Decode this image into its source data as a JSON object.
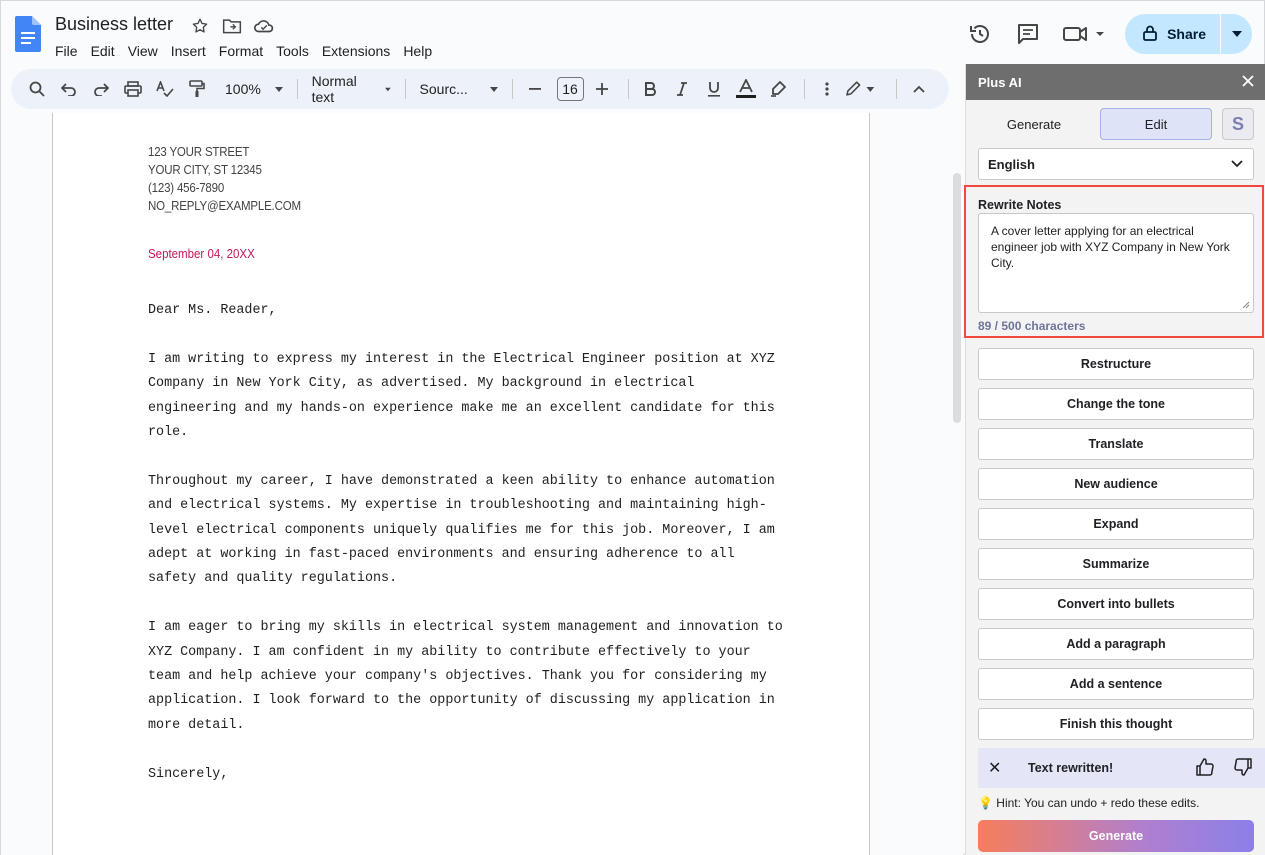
{
  "header": {
    "doc_title": "Business letter",
    "menu": [
      "File",
      "Edit",
      "View",
      "Insert",
      "Format",
      "Tools",
      "Extensions",
      "Help"
    ],
    "share_label": "Share"
  },
  "toolbar": {
    "zoom": "100%",
    "style": "Normal text",
    "font": "Sourc...",
    "font_size": "16"
  },
  "document": {
    "address": [
      "123 YOUR STREET",
      "YOUR CITY, ST 12345",
      "(123) 456-7890",
      "NO_REPLY@EXAMPLE.COM"
    ],
    "date": "September 04, 20XX",
    "paragraphs": [
      "Dear Ms. Reader,",
      "I am writing to express my interest in the Electrical Engineer position at XYZ Company in New York City, as advertised. My background in electrical engineering and my hands-on experience make me an excellent candidate for this role.",
      "Throughout my career, I have demonstrated a keen ability to enhance automation and electrical systems. My expertise in troubleshooting and maintaining high-level electrical components uniquely qualifies me for this job. Moreover, I am adept at working in fast-paced environments and ensuring adherence to all safety and quality regulations.",
      "I am eager to bring my skills in electrical system management and innovation to XYZ Company. I am confident in my ability to contribute effectively to your team and help achieve your company's objectives. Thank you for considering my application. I look forward to the opportunity of discussing my application in more detail.",
      "Sincerely,"
    ]
  },
  "panel": {
    "title": "Plus AI",
    "tabs": [
      "Generate",
      "Edit"
    ],
    "badge": "S",
    "language": "English",
    "notes_label": "Rewrite Notes",
    "notes_text": "A cover letter applying for an electrical engineer job with XYZ Company in New York City.",
    "notes_count": "89 / 500 characters",
    "actions": [
      "Restructure",
      "Change the tone",
      "Translate",
      "New audience",
      "Expand",
      "Summarize",
      "Convert into bullets",
      "Add a paragraph",
      "Add a sentence",
      "Finish this thought"
    ],
    "status": "Text rewritten!",
    "hint": "Hint: You can undo + redo these edits.",
    "generate_label": "Generate"
  },
  "colors": {
    "accent_share": "#c2e7ff",
    "date_color": "#c2185b",
    "highlight_border": "#f04a3e"
  }
}
